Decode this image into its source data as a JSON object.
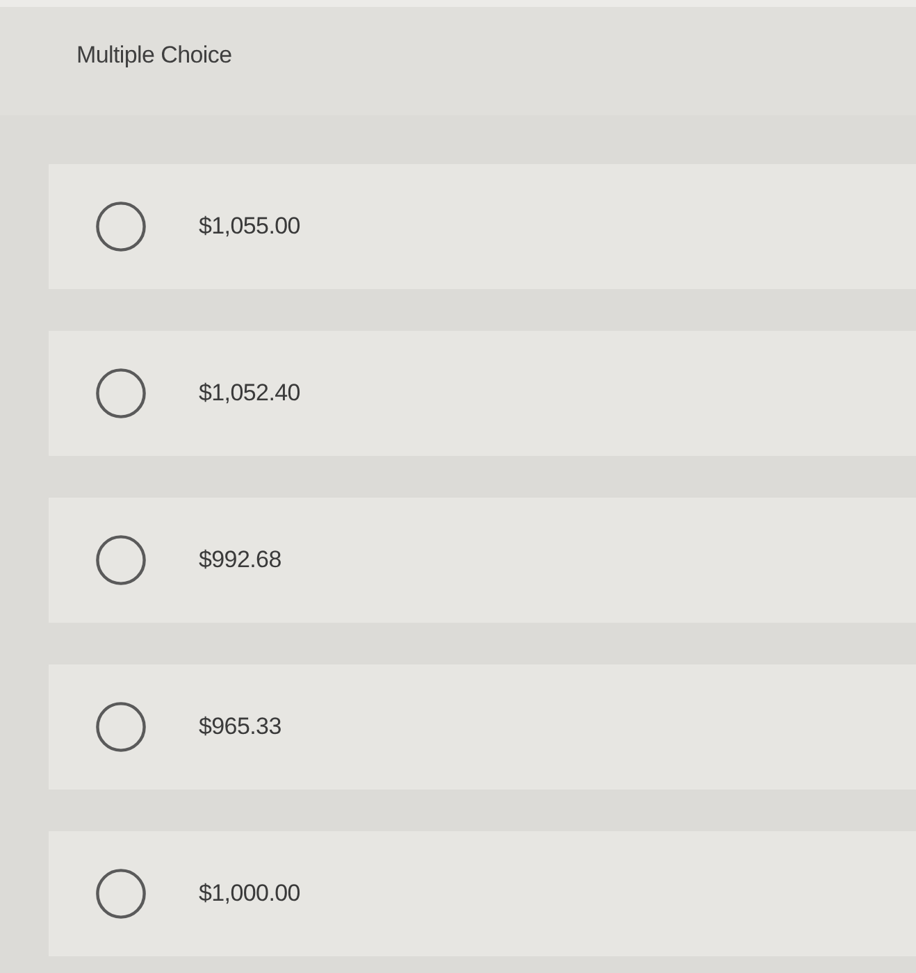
{
  "question": {
    "type_label": "Multiple Choice"
  },
  "options": [
    {
      "label": "$1,055.00",
      "selected": false
    },
    {
      "label": "$1,052.40",
      "selected": false
    },
    {
      "label": "$992.68",
      "selected": false
    },
    {
      "label": "$965.33",
      "selected": false
    },
    {
      "label": "$1,000.00",
      "selected": false
    }
  ]
}
